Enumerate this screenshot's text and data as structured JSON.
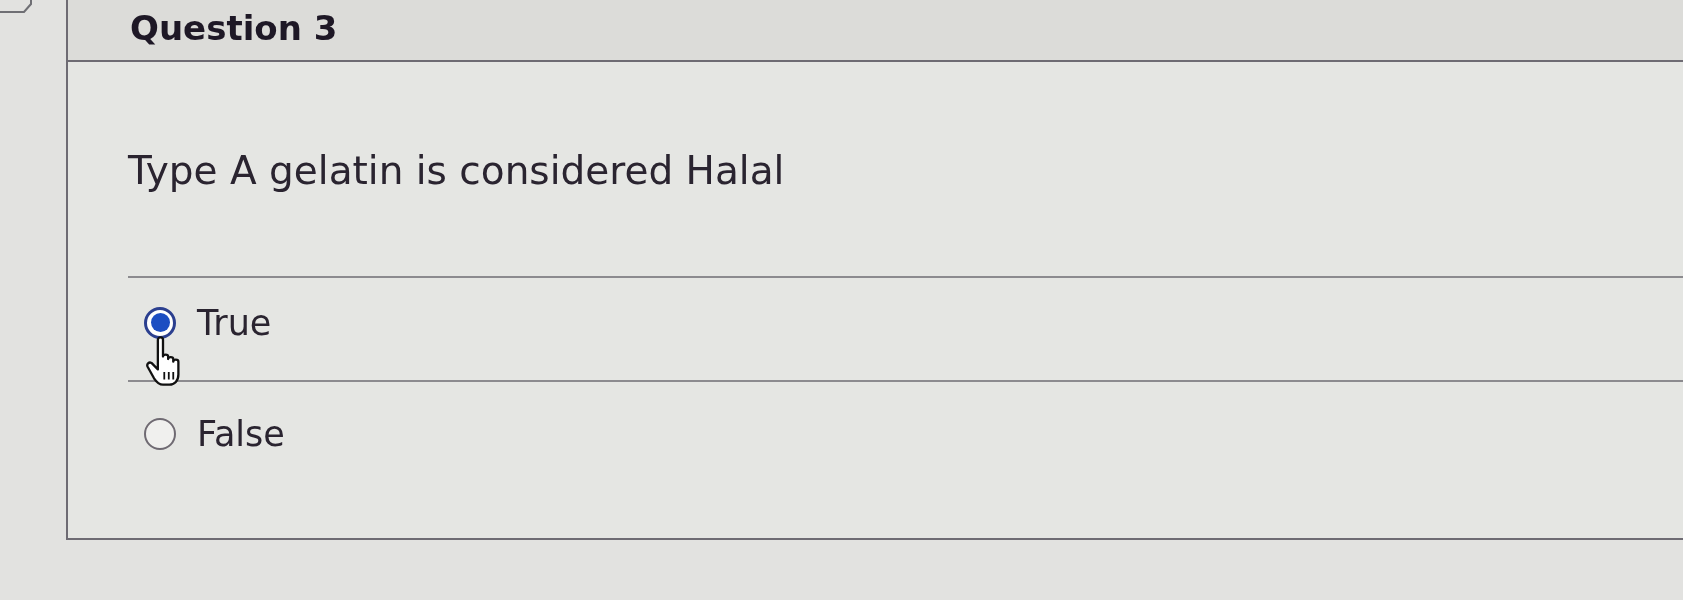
{
  "question_header": {
    "title": "Question 3"
  },
  "question": {
    "text": "Type A gelatin is considered Halal"
  },
  "answers": [
    {
      "label": "True",
      "selected": true
    },
    {
      "label": "False",
      "selected": false
    }
  ]
}
